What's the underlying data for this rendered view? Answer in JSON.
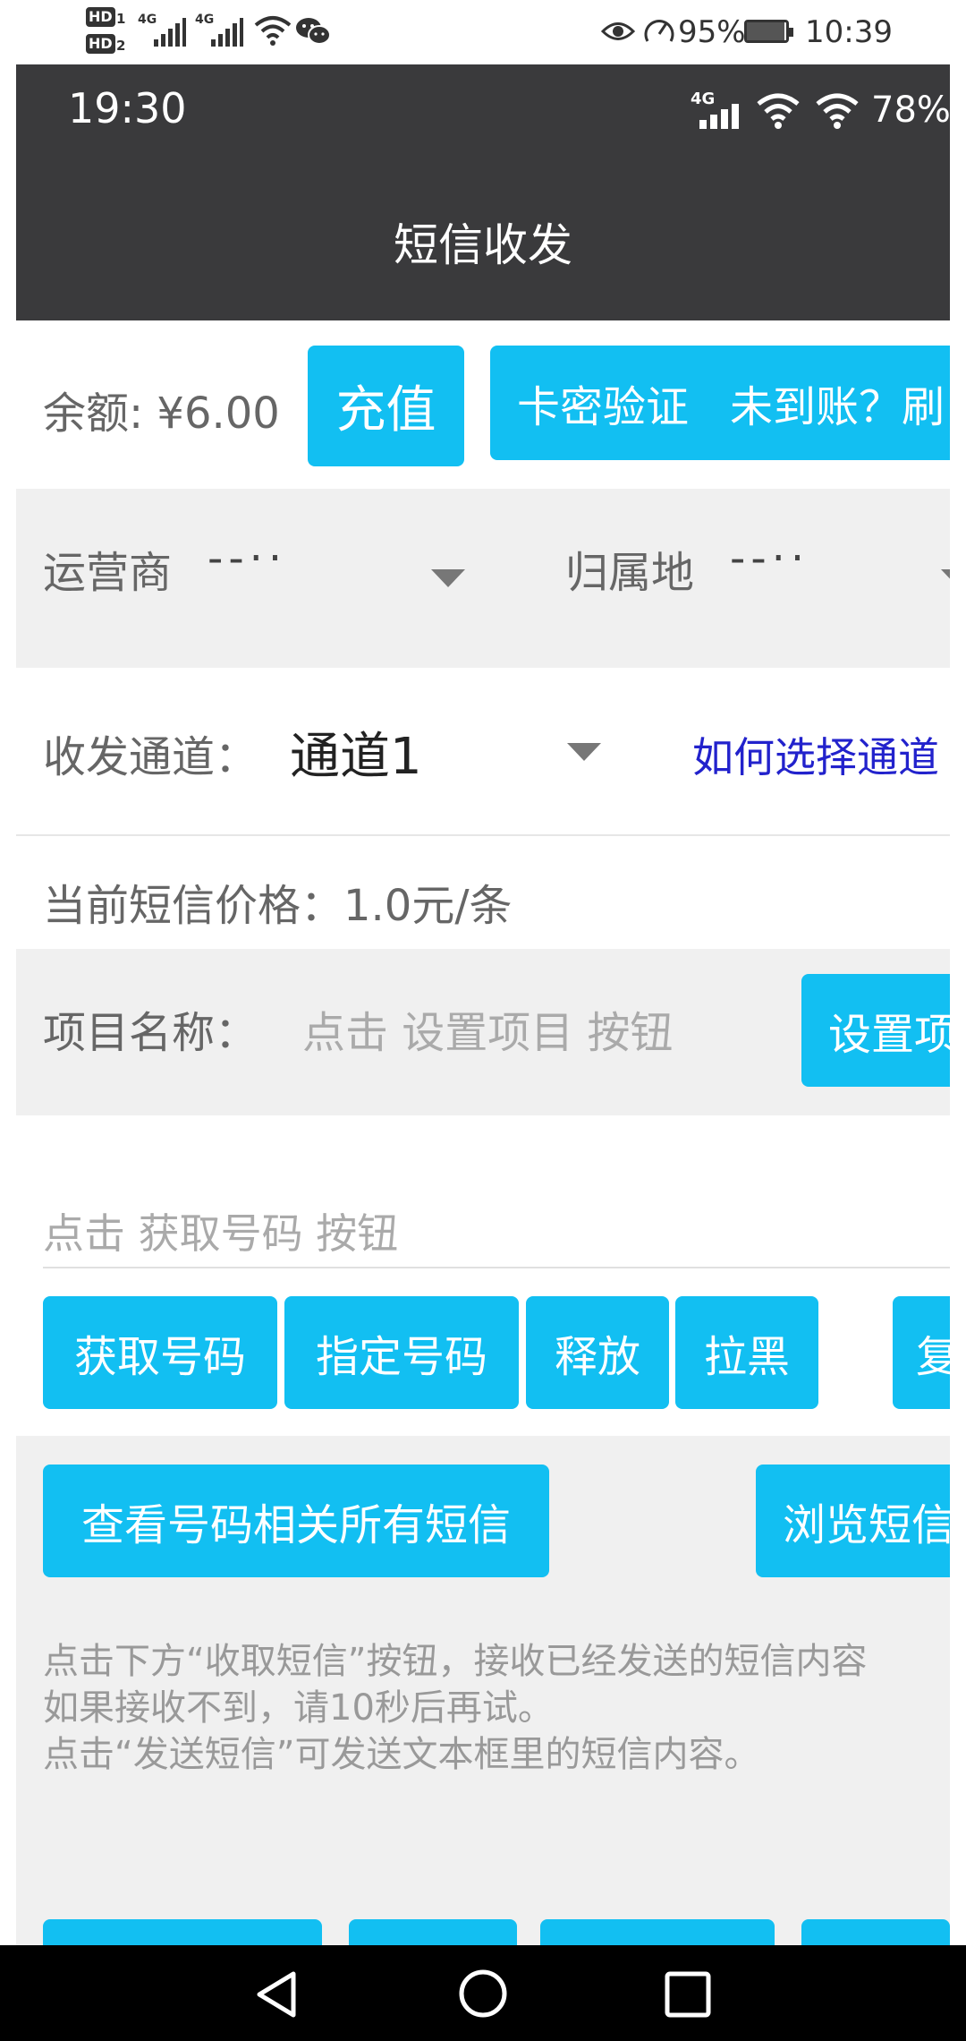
{
  "system_status": {
    "hd1": "HD",
    "hd1_sub": "1",
    "hd2": "HD",
    "hd2_sub": "2",
    "net1": "4G",
    "net2": "4G",
    "battery": "95%",
    "battery_level": 0.95,
    "time": "10:39"
  },
  "app_status": {
    "time": "19:30",
    "network": "4G",
    "battery": "78%"
  },
  "header": {
    "title": "短信收发"
  },
  "balance": {
    "label": "余额: ¥6.00",
    "recharge": "充值",
    "card_verify": "卡密验证",
    "not_arrived": "未到账？刷"
  },
  "filters": {
    "carrier_label": "运营商",
    "carrier_value": "--··",
    "region_label": "归属地",
    "region_value": "--··"
  },
  "channel": {
    "label": "收发通道：",
    "value": "通道1",
    "help_link": "如何选择通道"
  },
  "price": {
    "text": "当前短信价格：1.0元/条"
  },
  "project": {
    "label": "项目名称：",
    "placeholder": "点击 设置项目 按钮",
    "set_button": "设置项"
  },
  "phone": {
    "placeholder": "点击 获取号码 按钮"
  },
  "actions": {
    "get_number": "获取号码",
    "specify_number": "指定号码",
    "release": "释放",
    "blacklist": "拉黑",
    "copy": "复"
  },
  "sms": {
    "view_all": "查看号码相关所有短信",
    "browse": "浏览短信",
    "instruction_1": "点击下方“收取短信”按钮，接收已经发送的短信内容",
    "instruction_2": "如果接收不到，请10秒后再试。",
    "instruction_3": "点击“发送短信”可发送文本框里的短信内容。"
  },
  "colors": {
    "accent": "#12bff2",
    "appbar": "#3a3a3c",
    "link": "#2222cc",
    "panel": "#f0f0f0"
  }
}
